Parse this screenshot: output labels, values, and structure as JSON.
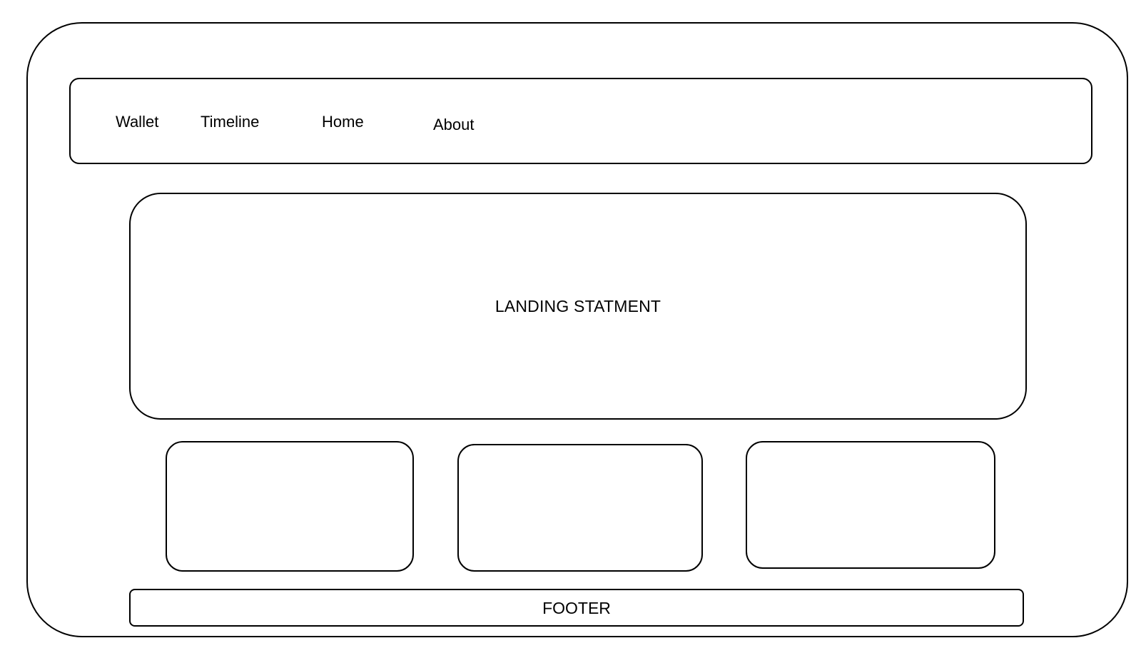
{
  "nav": {
    "items": [
      {
        "label": "Wallet"
      },
      {
        "label": "Timeline"
      },
      {
        "label": "Home"
      },
      {
        "label": "About"
      }
    ]
  },
  "hero": {
    "text": "LANDING STATMENT"
  },
  "footer": {
    "text": "FOOTER"
  }
}
